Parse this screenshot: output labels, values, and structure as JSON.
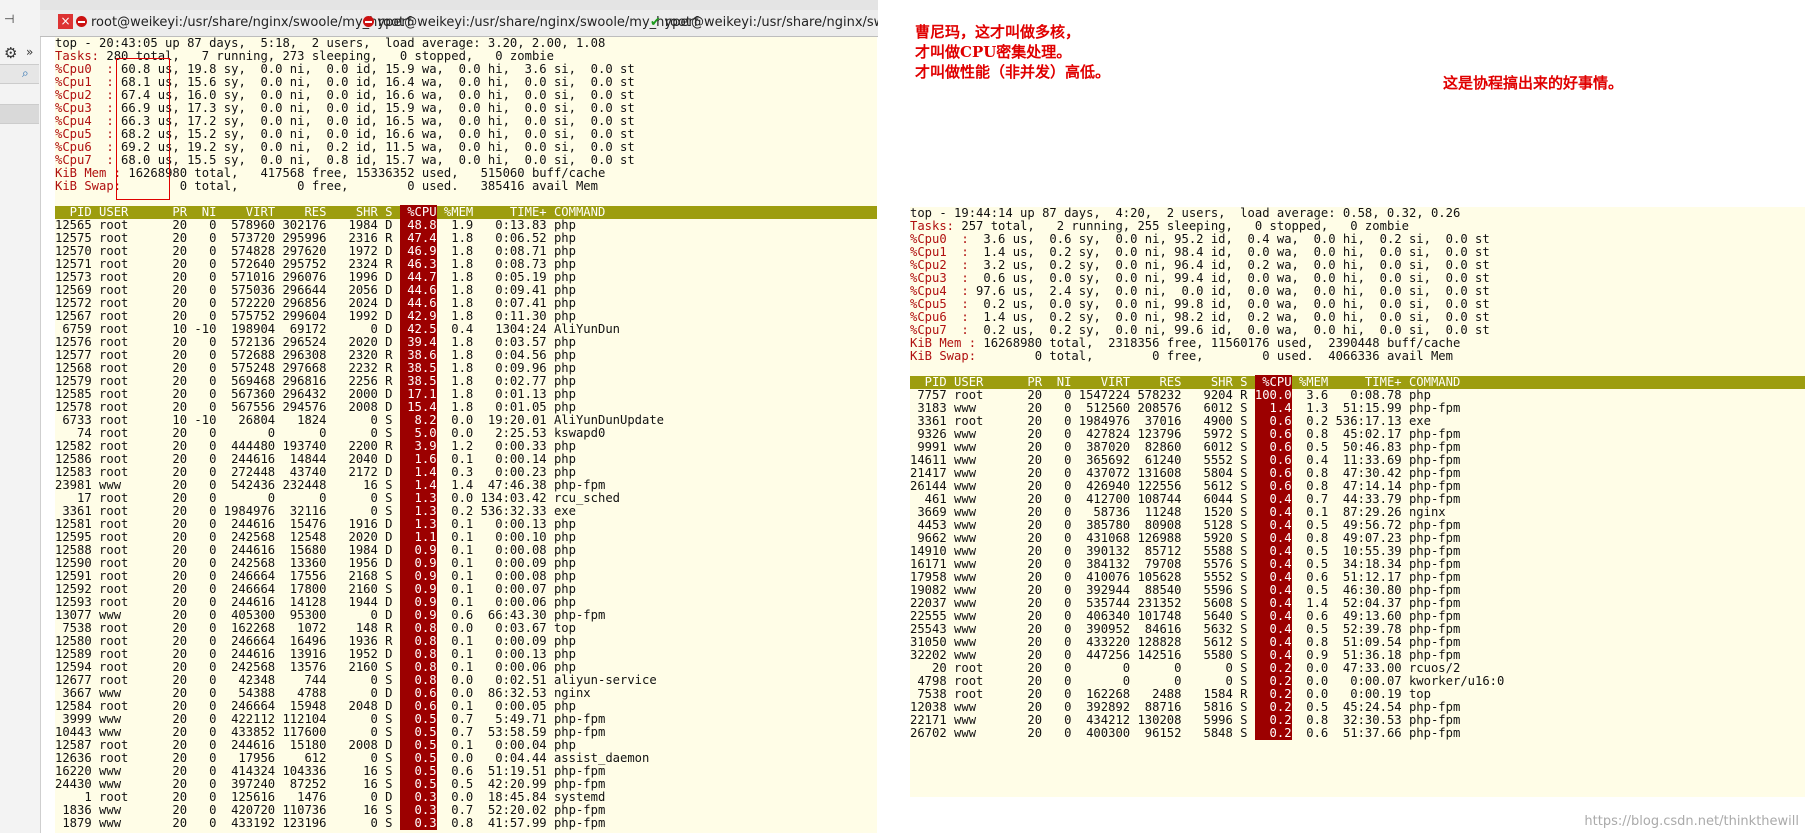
{
  "tabs": [
    {
      "label": "root@weikeyi:/usr/share/nginx/swoole/my_hyperf",
      "icon": "stop-icon"
    },
    {
      "label": "root@weikeyi:/usr/share/nginx/swoole/my_hyperf",
      "icon": "stop-icon"
    },
    {
      "label": "root@weikeyi:/usr/share/nginx/swoole/my_hyperf",
      "icon": "check-icon"
    }
  ],
  "annotations": {
    "left_lines": [
      "曹尼玛，这才叫做多核，",
      "才叫做CPU密集处理。",
      "才叫做性能（非并发）高低。"
    ],
    "right": "这是协程搞出来的好事情。"
  },
  "watermark": "https://blog.csdn.net/thinkthewill",
  "left_top": {
    "summary": [
      "top - 20:43:05 up 87 days,  5:18,  2 users,  load average: 3.20, 2.00, 1.08",
      "Tasks: 280 total,   7 running, 273 sleeping,   0 stopped,   0 zombie",
      "%Cpu0  : 60.8 us, 19.8 sy,  0.0 ni,  0.0 id, 15.9 wa,  0.0 hi,  3.6 si,  0.0 st",
      "%Cpu1  : 68.1 us, 15.6 sy,  0.0 ni,  0.0 id, 16.4 wa,  0.0 hi,  0.0 si,  0.0 st",
      "%Cpu2  : 67.4 us, 16.0 sy,  0.0 ni,  0.0 id, 16.6 wa,  0.0 hi,  0.0 si,  0.0 st",
      "%Cpu3  : 66.9 us, 17.3 sy,  0.0 ni,  0.0 id, 15.9 wa,  0.0 hi,  0.0 si,  0.0 st",
      "%Cpu4  : 66.3 us, 17.2 sy,  0.0 ni,  0.0 id, 16.5 wa,  0.0 hi,  0.0 si,  0.0 st",
      "%Cpu5  : 68.2 us, 15.2 sy,  0.0 ni,  0.0 id, 16.6 wa,  0.0 hi,  0.0 si,  0.0 st",
      "%Cpu6  : 69.2 us, 19.2 sy,  0.0 ni,  0.2 id, 11.5 wa,  0.0 hi,  0.0 si,  0.0 st",
      "%Cpu7  : 68.0 us, 15.5 sy,  0.0 ni,  0.8 id, 15.7 wa,  0.0 hi,  0.0 si,  0.0 st",
      "KiB Mem : 16268980 total,   417568 free, 15336352 used,   515060 buff/cache",
      "KiB Swap:        0 total,        0 free,        0 used.   385416 avail Mem",
      ""
    ],
    "header_pre": "  PID USER      PR  NI    VIRT    RES    SHR S ",
    "header_cpu": " %CPU",
    "header_post": " %MEM     TIME+ COMMAND",
    "rows": [
      [
        "12565 root      20   0  578960 302176   1984 D ",
        "48.8",
        "  1.9   0:13.83 php"
      ],
      [
        "12575 root      20   0  573720 295996   2316 R ",
        "47.4",
        "  1.8   0:06.52 php"
      ],
      [
        "12570 root      20   0  574828 297620   1972 D ",
        "46.9",
        "  1.8   0:08.71 php"
      ],
      [
        "12571 root      20   0  572640 295752   2324 R ",
        "46.3",
        "  1.8   0:08.73 php"
      ],
      [
        "12573 root      20   0  571016 296076   1996 D ",
        "44.7",
        "  1.8   0:05.19 php"
      ],
      [
        "12569 root      20   0  575036 296644   2056 D ",
        "44.6",
        "  1.8   0:09.41 php"
      ],
      [
        "12572 root      20   0  572220 296856   2024 D ",
        "44.6",
        "  1.8   0:07.41 php"
      ],
      [
        "12567 root      20   0  575752 299604   1992 D ",
        "42.9",
        "  1.8   0:11.30 php"
      ],
      [
        " 6759 root      10 -10  198904  69172      0 D ",
        "42.5",
        "  0.4   1304:24 AliYunDun"
      ],
      [
        "12576 root      20   0  572136 296524   2020 D ",
        "39.4",
        "  1.8   0:03.57 php"
      ],
      [
        "12577 root      20   0  572688 296308   2320 R ",
        "38.6",
        "  1.8   0:04.56 php"
      ],
      [
        "12568 root      20   0  575248 297668   2232 R ",
        "38.5",
        "  1.8   0:09.96 php"
      ],
      [
        "12579 root      20   0  569468 296816   2256 R ",
        "38.5",
        "  1.8   0:02.77 php"
      ],
      [
        "12585 root      20   0  567360 296432   2000 D ",
        "17.1",
        "  1.8   0:01.13 php"
      ],
      [
        "12578 root      20   0  567556 294576   2008 D ",
        "15.4",
        "  1.8   0:01.05 php"
      ],
      [
        " 6733 root      10 -10   26804   1824      0 S ",
        "  8.2",
        "  0.0  19:20.01 AliYunDunUpdate"
      ],
      [
        "   74 root      20   0       0      0      0 S ",
        "  5.0",
        "  0.0   2:25.53 kswapd0"
      ],
      [
        "12582 root      20   0  444480 193740   2200 R ",
        "  3.9",
        "  1.2   0:00.33 php"
      ],
      [
        "12586 root      20   0  244616  14844   2040 D ",
        "  1.6",
        "  0.1   0:00.14 php"
      ],
      [
        "12583 root      20   0  272448  43740   2172 D ",
        "  1.4",
        "  0.3   0:00.23 php"
      ],
      [
        "23981 www       20   0  542436 232448     16 S ",
        "  1.4",
        "  1.4  47:46.38 php-fpm"
      ],
      [
        "   17 root      20   0       0      0      0 S ",
        "  1.3",
        "  0.0 134:03.42 rcu_sched"
      ],
      [
        " 3361 root      20   0 1984976  32116      0 S ",
        "  1.3",
        "  0.2 536:32.33 exe"
      ],
      [
        "12581 root      20   0  244616  15476   1916 D ",
        "  1.3",
        "  0.1   0:00.13 php"
      ],
      [
        "12595 root      20   0  242568  12548   2020 D ",
        "  1.1",
        "  0.1   0:00.10 php"
      ],
      [
        "12588 root      20   0  244616  15680   1984 D ",
        "  0.9",
        "  0.1   0:00.08 php"
      ],
      [
        "12590 root      20   0  242568  13360   1956 D ",
        "  0.9",
        "  0.1   0:00.09 php"
      ],
      [
        "12591 root      20   0  246664  17556   2168 S ",
        "  0.9",
        "  0.1   0:00.08 php"
      ],
      [
        "12592 root      20   0  246664  17800   2160 S ",
        "  0.9",
        "  0.1   0:00.07 php"
      ],
      [
        "12593 root      20   0  244616  14128   1944 D ",
        "  0.9",
        "  0.1   0:00.06 php"
      ],
      [
        "13077 www       20   0  405300  95300      0 D ",
        "  0.9",
        "  0.6  66:43.30 php-fpm"
      ],
      [
        " 7538 root      20   0  162268   1072    148 R ",
        "  0.8",
        "  0.0   0:03.67 top"
      ],
      [
        "12580 root      20   0  246664  16496   1936 R ",
        "  0.8",
        "  0.1   0:00.09 php"
      ],
      [
        "12589 root      20   0  244616  13916   1952 D ",
        "  0.8",
        "  0.1   0:00.13 php"
      ],
      [
        "12594 root      20   0  242568  13576   2160 S ",
        "  0.8",
        "  0.1   0:00.06 php"
      ],
      [
        "12677 root      20   0   42348    744      0 S ",
        "  0.8",
        "  0.0   0:02.51 aliyun-service"
      ],
      [
        " 3667 www       20   0   54388   4788      0 D ",
        "  0.6",
        "  0.0  86:32.53 nginx"
      ],
      [
        "12584 root      20   0  246664  15948   2048 D ",
        "  0.6",
        "  0.1   0:00.05 php"
      ],
      [
        " 3999 www       20   0  422112 112104      0 S ",
        "  0.5",
        "  0.7   5:49.71 php-fpm"
      ],
      [
        "10443 www       20   0  433852 117600      0 S ",
        "  0.5",
        "  0.7  53:58.59 php-fpm"
      ],
      [
        "12587 root      20   0  244616  15180   2008 D ",
        "  0.5",
        "  0.1   0:00.04 php"
      ],
      [
        "12636 root      20   0   17956    612      0 S ",
        "  0.5",
        "  0.0   0:04.44 assist_daemon"
      ],
      [
        "16220 www       20   0  414324 104336     16 S ",
        "  0.5",
        "  0.6  51:19.51 php-fpm"
      ],
      [
        "24430 www       20   0  397240  87252     16 S ",
        "  0.5",
        "  0.5  42:20.99 php-fpm"
      ],
      [
        "    1 root      20   0  125616   1476      0 D ",
        "  0.3",
        "  0.0  18:45.84 systemd"
      ],
      [
        " 1836 www       20   0  420720 110736     16 S ",
        "  0.3",
        "  0.7  52:20.02 php-fpm"
      ],
      [
        " 1879 www       20   0  433192 123196      0 S ",
        "  0.3",
        "  0.8  41:57.99 php-fpm"
      ]
    ]
  },
  "right_top": {
    "summary": [
      "top - 19:44:14 up 87 days,  4:20,  2 users,  load average: 0.58, 0.32, 0.26",
      "Tasks: 257 total,   2 running, 255 sleeping,   0 stopped,   0 zombie",
      "%Cpu0  :  3.6 us,  0.6 sy,  0.0 ni, 95.2 id,  0.4 wa,  0.0 hi,  0.2 si,  0.0 st",
      "%Cpu1  :  1.4 us,  0.2 sy,  0.0 ni, 98.4 id,  0.0 wa,  0.0 hi,  0.0 si,  0.0 st",
      "%Cpu2  :  3.2 us,  0.2 sy,  0.0 ni, 96.4 id,  0.2 wa,  0.0 hi,  0.0 si,  0.0 st",
      "%Cpu3  :  0.6 us,  0.0 sy,  0.0 ni, 99.4 id,  0.0 wa,  0.0 hi,  0.0 si,  0.0 st",
      "%Cpu4  : 97.6 us,  2.4 sy,  0.0 ni,  0.0 id,  0.0 wa,  0.0 hi,  0.0 si,  0.0 st",
      "%Cpu5  :  0.2 us,  0.0 sy,  0.0 ni, 99.8 id,  0.0 wa,  0.0 hi,  0.0 si,  0.0 st",
      "%Cpu6  :  1.4 us,  0.2 sy,  0.0 ni, 98.2 id,  0.2 wa,  0.0 hi,  0.0 si,  0.0 st",
      "%Cpu7  :  0.2 us,  0.2 sy,  0.0 ni, 99.6 id,  0.0 wa,  0.0 hi,  0.0 si,  0.0 st",
      "KiB Mem : 16268980 total,  2318356 free, 11560176 used,  2390448 buff/cache",
      "KiB Swap:        0 total,        0 free,        0 used.  4066336 avail Mem",
      ""
    ],
    "header_pre": "  PID USER      PR  NI    VIRT    RES    SHR S ",
    "header_cpu": " %CPU",
    "header_post": " %MEM     TIME+ COMMAND",
    "rows": [
      [
        " 7757 root      20   0 1547224 578232   9204 R ",
        "100.0",
        "  3.6   0:08.78 php"
      ],
      [
        " 3183 www       20   0  512560 208576   6012 S ",
        "  1.4",
        "  1.3  51:15.99 php-fpm"
      ],
      [
        " 3361 root      20   0 1984976  37016   4900 S ",
        "  0.6",
        "  0.2 536:17.13 exe"
      ],
      [
        " 9326 www       20   0  427824 123796   5972 S ",
        "  0.6",
        "  0.8  45:02.17 php-fpm"
      ],
      [
        " 9991 www       20   0  387020  82860   6012 S ",
        "  0.6",
        "  0.5  50:46.83 php-fpm"
      ],
      [
        "14611 www       20   0  365692  61240   5552 S ",
        "  0.6",
        "  0.4  11:33.69 php-fpm"
      ],
      [
        "21417 www       20   0  437072 131608   5804 S ",
        "  0.6",
        "  0.8  47:30.42 php-fpm"
      ],
      [
        "26144 www       20   0  426940 122556   5612 S ",
        "  0.6",
        "  0.8  47:14.14 php-fpm"
      ],
      [
        "  461 www       20   0  412700 108744   6044 S ",
        "  0.4",
        "  0.7  44:33.79 php-fpm"
      ],
      [
        " 3669 www       20   0   58736  11248   1520 S ",
        "  0.4",
        "  0.1  87:29.26 nginx"
      ],
      [
        " 4453 www       20   0  385780  80908   5128 S ",
        "  0.4",
        "  0.5  49:56.72 php-fpm"
      ],
      [
        " 9662 www       20   0  431068 126988   5920 S ",
        "  0.4",
        "  0.8  49:07.23 php-fpm"
      ],
      [
        "14910 www       20   0  390132  85712   5588 S ",
        "  0.4",
        "  0.5  10:55.39 php-fpm"
      ],
      [
        "16171 www       20   0  384132  79708   5576 S ",
        "  0.4",
        "  0.5  34:18.34 php-fpm"
      ],
      [
        "17958 www       20   0  410076 105628   5552 S ",
        "  0.4",
        "  0.6  51:12.17 php-fpm"
      ],
      [
        "19082 www       20   0  392944  88540   5596 S ",
        "  0.4",
        "  0.5  46:30.80 php-fpm"
      ],
      [
        "22037 www       20   0  535744 231352   5608 S ",
        "  0.4",
        "  1.4  52:04.37 php-fpm"
      ],
      [
        "22555 www       20   0  406340 101748   5640 S ",
        "  0.4",
        "  0.6  49:13.60 php-fpm"
      ],
      [
        "25543 www       20   0  390952  84616   5632 S ",
        "  0.4",
        "  0.5  52:39.78 php-fpm"
      ],
      [
        "31050 www       20   0  433220 128828   5612 S ",
        "  0.4",
        "  0.8  51:09.54 php-fpm"
      ],
      [
        "32202 www       20   0  447256 142516   5580 S ",
        "  0.4",
        "  0.9  51:36.18 php-fpm"
      ],
      [
        "   20 root      20   0       0      0      0 S ",
        "  0.2",
        "  0.0  47:33.00 rcuos/2"
      ],
      [
        " 4798 root      20   0       0      0      0 S ",
        "  0.2",
        "  0.0   0:00.07 kworker/u16:0"
      ],
      [
        " 7538 root      20   0  162268   2488   1584 R ",
        "  0.2",
        "  0.0   0:00.19 top"
      ],
      [
        "12038 www       20   0  392892  88716   5816 S ",
        "  0.2",
        "  0.5  45:24.54 php-fpm"
      ],
      [
        "22171 www       20   0  434212 130208   5996 S ",
        "  0.2",
        "  0.8  32:30.53 php-fpm"
      ],
      [
        "26702 www       20   0  400300  96152   5848 S ",
        "  0.2",
        "  0.6  51:37.66 php-fpm"
      ]
    ]
  }
}
